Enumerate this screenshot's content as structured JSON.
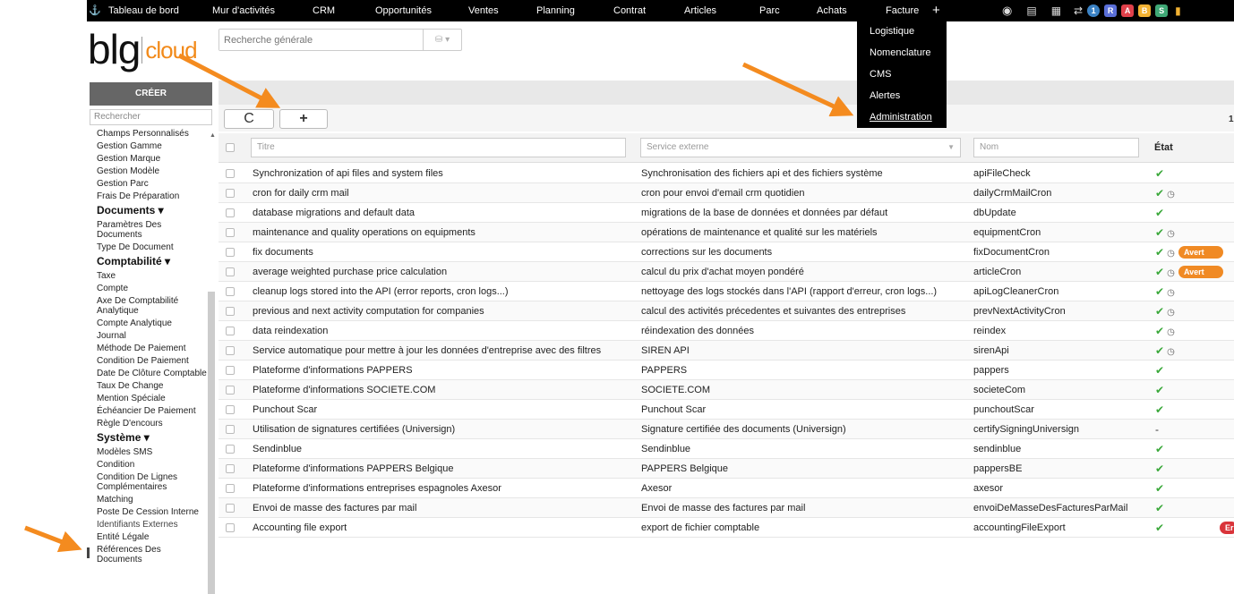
{
  "nav": {
    "items": [
      "Tableau de bord",
      "Mur d'activités",
      "CRM",
      "Opportunités",
      "Ventes",
      "Planning",
      "Contrat",
      "Articles",
      "Parc",
      "Achats",
      "Facture"
    ],
    "plus": "+",
    "badges": [
      {
        "label": "1",
        "color": "#3b82c4"
      },
      {
        "label": "R",
        "color": "#5a6fd8"
      },
      {
        "label": "A",
        "color": "#e0414b"
      },
      {
        "label": "B",
        "color": "#f2b233"
      },
      {
        "label": "S",
        "color": "#3fa876"
      }
    ]
  },
  "logo": {
    "part1": "blg",
    "part2": "cloud"
  },
  "search": {
    "placeholder": "Recherche générale",
    "icon": "database-icon"
  },
  "sidebar": {
    "create_label": "CRÉER",
    "search_placeholder": "Rechercher",
    "items": [
      {
        "type": "item",
        "label": "Champs Personnalisés"
      },
      {
        "type": "item",
        "label": "Gestion Gamme"
      },
      {
        "type": "item",
        "label": "Gestion Marque"
      },
      {
        "type": "item",
        "label": "Gestion Modèle"
      },
      {
        "type": "item",
        "label": "Gestion Parc"
      },
      {
        "type": "item",
        "label": "Frais De Préparation"
      },
      {
        "type": "head",
        "label": "Documents ▾"
      },
      {
        "type": "item",
        "label": "Paramètres Des Documents"
      },
      {
        "type": "item",
        "label": "Type De Document"
      },
      {
        "type": "head",
        "label": "Comptabilité ▾"
      },
      {
        "type": "item",
        "label": "Taxe"
      },
      {
        "type": "item",
        "label": "Compte"
      },
      {
        "type": "item",
        "label": "Axe De Comptabilité Analytique"
      },
      {
        "type": "item",
        "label": "Compte Analytique"
      },
      {
        "type": "item",
        "label": "Journal"
      },
      {
        "type": "item",
        "label": "Méthode De Paiement"
      },
      {
        "type": "item",
        "label": "Condition De Paiement"
      },
      {
        "type": "item",
        "label": "Date De Clôture Comptable"
      },
      {
        "type": "item",
        "label": "Taux De Change"
      },
      {
        "type": "item",
        "label": "Mention Spéciale"
      },
      {
        "type": "item",
        "label": "Échéancier De Paiement"
      },
      {
        "type": "item",
        "label": "Règle D'encours"
      },
      {
        "type": "head",
        "label": "Système ▾"
      },
      {
        "type": "item",
        "label": "Modèles SMS"
      },
      {
        "type": "item",
        "label": "Condition"
      },
      {
        "type": "item",
        "label": "Condition De Lignes Complémentaires"
      },
      {
        "type": "item",
        "label": "Matching"
      },
      {
        "type": "item",
        "label": "Poste De Cession Interne"
      },
      {
        "type": "item",
        "label": "Identifiants Externes",
        "active": true
      },
      {
        "type": "item",
        "label": "Entité Légale"
      },
      {
        "type": "item",
        "label": "Références Des Documents"
      }
    ]
  },
  "toolbar": {
    "refresh": "C",
    "add": "+"
  },
  "page_number": "1",
  "table": {
    "filters": {
      "titre": "Titre",
      "service": "Service externe",
      "nom": "Nom"
    },
    "etat_header": "État",
    "rows": [
      {
        "titre": "Synchronization of api files and system files",
        "service": "Synchronisation des fichiers api et des fichiers système",
        "nom": "apiFileCheck",
        "etat": "✔",
        "clock": false,
        "tag": ""
      },
      {
        "titre": "cron for daily crm mail",
        "service": "cron pour envoi d'email crm quotidien",
        "nom": "dailyCrmMailCron",
        "etat": "✔",
        "clock": true,
        "tag": ""
      },
      {
        "titre": "database migrations and default data",
        "service": "migrations de la base de données et données par défaut",
        "nom": "dbUpdate",
        "etat": "✔",
        "clock": false,
        "tag": ""
      },
      {
        "titre": "maintenance and quality operations on equipments",
        "service": "opérations de maintenance et qualité sur les matériels",
        "nom": "equipmentCron",
        "etat": "✔",
        "clock": true,
        "tag": ""
      },
      {
        "titre": "fix documents",
        "service": "corrections sur les documents",
        "nom": "fixDocumentCron",
        "etat": "✔",
        "clock": true,
        "tag": "Avert"
      },
      {
        "titre": "average weighted purchase price calculation",
        "service": "calcul du prix d'achat moyen pondéré",
        "nom": "articleCron",
        "etat": "✔",
        "clock": true,
        "tag": "Avert"
      },
      {
        "titre": "cleanup logs stored into the API (error reports, cron logs...)",
        "service": "nettoyage des logs stockés dans l'API (rapport d'erreur, cron logs...)",
        "nom": "apiLogCleanerCron",
        "etat": "✔",
        "clock": true,
        "tag": ""
      },
      {
        "titre": "previous and next activity computation for companies",
        "service": "calcul des activités précedentes et suivantes des entreprises",
        "nom": "prevNextActivityCron",
        "etat": "✔",
        "clock": true,
        "tag": ""
      },
      {
        "titre": "data reindexation",
        "service": "réindexation des données",
        "nom": "reindex",
        "etat": "✔",
        "clock": true,
        "tag": ""
      },
      {
        "titre": "Service automatique pour mettre à jour les données d'entreprise avec des filtres",
        "service": "SIREN API",
        "nom": "sirenApi",
        "etat": "✔",
        "clock": true,
        "tag": ""
      },
      {
        "titre": "Plateforme d'informations PAPPERS",
        "service": "PAPPERS",
        "nom": "pappers",
        "etat": "✔",
        "clock": false,
        "tag": ""
      },
      {
        "titre": "Plateforme d'informations SOCIETE.COM",
        "service": "SOCIETE.COM",
        "nom": "societeCom",
        "etat": "✔",
        "clock": false,
        "tag": ""
      },
      {
        "titre": "Punchout Scar",
        "service": "Punchout Scar",
        "nom": "punchoutScar",
        "etat": "✔",
        "clock": false,
        "tag": ""
      },
      {
        "titre": "Utilisation de signatures certifiées (Universign)",
        "service": "Signature certifiée des documents (Universign)",
        "nom": "certifySigningUniversign",
        "etat": "-",
        "clock": false,
        "tag": ""
      },
      {
        "titre": "Sendinblue",
        "service": "Sendinblue",
        "nom": "sendinblue",
        "etat": "✔",
        "clock": false,
        "tag": ""
      },
      {
        "titre": "Plateforme d'informations PAPPERS Belgique",
        "service": "PAPPERS Belgique",
        "nom": "pappersBE",
        "etat": "✔",
        "clock": false,
        "tag": ""
      },
      {
        "titre": "Plateforme d'informations entreprises espagnoles Axesor",
        "service": "Axesor",
        "nom": "axesor",
        "etat": "✔",
        "clock": false,
        "tag": ""
      },
      {
        "titre": "Envoi de masse des factures par mail",
        "service": "Envoi de masse des factures par mail",
        "nom": "envoiDeMasseDesFacturesParMail",
        "etat": "✔",
        "clock": false,
        "tag": ""
      },
      {
        "titre": "Accounting file export",
        "service": "export de fichier comptable",
        "nom": "accountingFileExport",
        "etat": "✔",
        "clock": false,
        "tag": "Er"
      }
    ]
  },
  "dropdown": {
    "items": [
      "Logistique",
      "Nomenclature",
      "CMS",
      "Alertes",
      "Administration"
    ],
    "selected": "Administration"
  },
  "colors": {
    "accent": "#f28a1a",
    "ok": "#3aa83a",
    "warn": "#f08a24",
    "err": "#d9343a"
  }
}
